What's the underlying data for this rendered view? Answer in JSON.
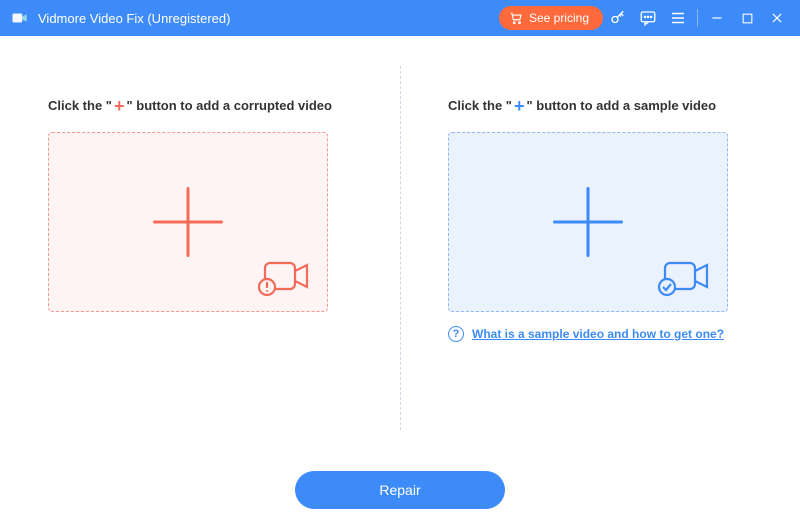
{
  "titlebar": {
    "app_title": "Vidmore Video Fix (Unregistered)",
    "see_pricing_label": "See pricing"
  },
  "panes": {
    "corrupted": {
      "instruction_pre": "Click the \"",
      "instruction_plus": "+",
      "instruction_post": "\" button to add a corrupted video"
    },
    "sample": {
      "instruction_pre": "Click the \"",
      "instruction_plus": "+",
      "instruction_post": "\" button to add a sample video",
      "help_text": "What is a sample video and how to get one?"
    }
  },
  "footer": {
    "repair_label": "Repair"
  }
}
